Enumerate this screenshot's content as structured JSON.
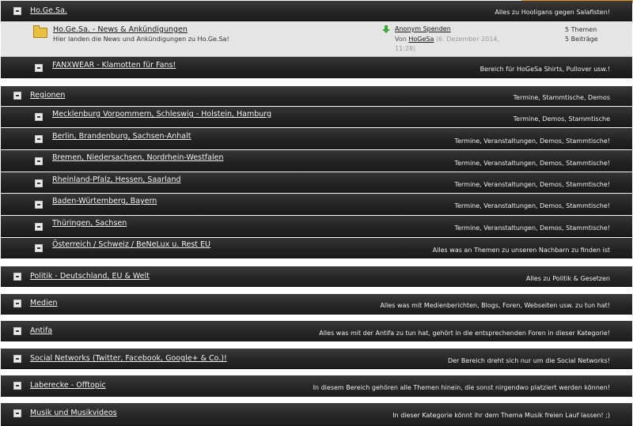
{
  "colors": {
    "accent": "#e79a2b",
    "bar": "#2a2a2a",
    "row_bg": "#e5e5e5",
    "folder": "#e9bf3f",
    "arrow": "#3aa83a"
  },
  "categories": [
    {
      "title": "Ho.Ge.Sa.",
      "desc": "Alles zu Hooligans gegen Salafisten!"
    },
    {
      "title": "Regionen",
      "desc": "Termine, Stammtische, Demos"
    },
    {
      "title": "Politik - Deutschland, EU & Welt",
      "desc": "Alles zu Politik & Gesetzen"
    },
    {
      "title": "Medien",
      "desc": "Alles was mit Medienberichten, Blogs, Foren, Webseiten usw. zu tun hat!"
    },
    {
      "title": "Antifa",
      "desc": "Alles was mit der Antifa zu tun hat, gehört in die entsprechenden Foren in dieser Kategorie!"
    },
    {
      "title": "Social Networks (Twitter, Facebook, Google+ & Co.)!",
      "desc": "Der Bereich dreht sich nur um die Social Networks!"
    },
    {
      "title": "Laberecke - Offtopic",
      "desc": "In diesem Bereich gehören alle Themen hinein, die sonst nirgendwo platziert werden können!"
    },
    {
      "title": "Musik und Musikvideos",
      "desc": "In dieser Kategorie könnt ihr dem Thema Musik freien Lauf lassen! ;)"
    }
  ],
  "forum": {
    "title": "Ho.Ge.Sa. - News & Ankündigungen",
    "desc": "Hier landen die News und Ankündigungen zu Ho.Ge.Sa!",
    "last_post_title": "Anonym Spenden",
    "last_post_by_prefix": "Von",
    "last_post_by": "HoGeSa",
    "last_post_date": "(6. Dezember 2014, 11:28)",
    "threads": "5 Themen",
    "posts": "5 Beiträge",
    "folder_icon": "folder-icon",
    "arrow_icon": "arrow-down-icon"
  },
  "subforums": [
    {
      "title": "FANXWEAR - Klamotten für Fans!",
      "desc": "Bereich für HoGeSa Shirts, Pullover usw.!"
    },
    {
      "title": "Mecklenburg Vorpommern, Schleswig - Holstein, Hamburg",
      "desc": "Termine, Demos, Stammtische"
    },
    {
      "title": "Berlin, Brandenburg, Sachsen-Anhalt",
      "desc": "Termine, Veranstaltungen, Demos, Stammtische!"
    },
    {
      "title": "Bremen, Niedersachsen, Nordrhein-Westfalen",
      "desc": "Termine, Veranstaltungen, Demos, Stammtische!"
    },
    {
      "title": "Rheinland-Pfalz, Hessen, Saarland",
      "desc": "Termine, Veranstaltungen, Demos, Stammtische!"
    },
    {
      "title": "Baden-Würtemberg, Bayern",
      "desc": "Termine, Veranstaltungen, Demos, Stammtische!"
    },
    {
      "title": "Thüringen, Sachsen",
      "desc": "Termine, Veranstaltungen, Demos, Stammtische!"
    },
    {
      "title": "Österreich / Schweiz / BeNeLux u. Rest EU",
      "desc": "Alles was an Themen zu unseren Nachbarn zu finden ist"
    }
  ]
}
